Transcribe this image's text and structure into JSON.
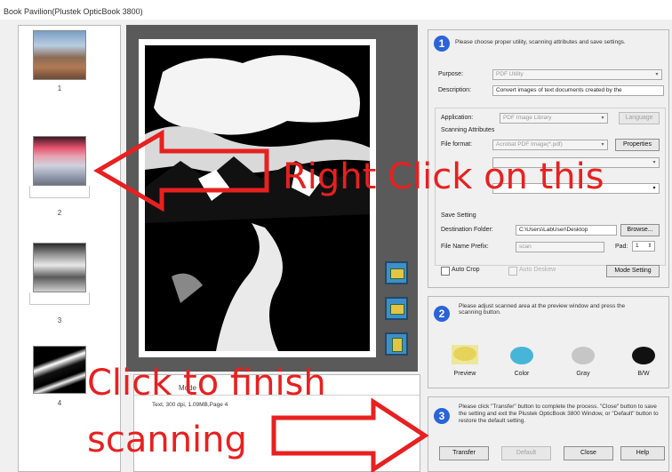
{
  "window": {
    "title": "Book Pavilion(Plustek OpticBook 3800)"
  },
  "thumbnails": [
    {
      "number": "1"
    },
    {
      "number": "2"
    },
    {
      "number": "3"
    },
    {
      "number": "4"
    }
  ],
  "info": {
    "text": "Text, 300 dpi, 1.09MB,Page 4",
    "mode_label": "Mode"
  },
  "step1": {
    "number": "1",
    "instruction": "Please choose proper utility, scanning attributes and save settings.",
    "purpose_label": "Purpose:",
    "purpose_value": "PDF Utility",
    "description_label": "Description:",
    "description_value": "Convert images of text documents created by the",
    "application_label": "Application:",
    "application_value": "PDF Image Library",
    "language_button": "Language",
    "scanning_attributes_label": "Scanning Attributes",
    "file_format_label": "File format:",
    "file_format_value": "Acrobat PDF Image(*.pdf)",
    "properties_button": "Properties",
    "save_setting_label": "Save Setting",
    "destination_label": "Destination Folder:",
    "destination_value": "C:\\Users\\LabUser\\Desktop",
    "browse_button": "Browse...",
    "prefix_label": "File Name Prefix:",
    "prefix_value": "scan",
    "pad_label": "Pad:",
    "pad_value": "1",
    "auto_crop_label": "Auto Crop",
    "auto_deskew_label": "Auto Deskew",
    "mode_setting_button": "Mode Setting"
  },
  "step2": {
    "number": "2",
    "instruction": "Please adjust scanned area at the preview window and press the scanning button.",
    "modes": [
      {
        "label": "Preview",
        "color": "#e6d35a"
      },
      {
        "label": "Color",
        "color": "#46b5d8"
      },
      {
        "label": "Gray",
        "color": "#c6c6c6"
      },
      {
        "label": "B/W",
        "color": "#111111"
      }
    ]
  },
  "step3": {
    "number": "3",
    "instruction": "Please click \"Transfer\" button to complete the process. \"Close\" button to save the setting and exit the Plustek OpticBook 3800 Window, or \"Default\" button to restore the default setting.",
    "transfer_button": "Transfer",
    "default_button": "Default",
    "close_button": "Close",
    "help_button": "Help"
  },
  "annotations": {
    "right_click": "Right Click on this",
    "finish_line1": "Click to finish",
    "finish_line2": "scanning",
    "color": "#e82020"
  }
}
